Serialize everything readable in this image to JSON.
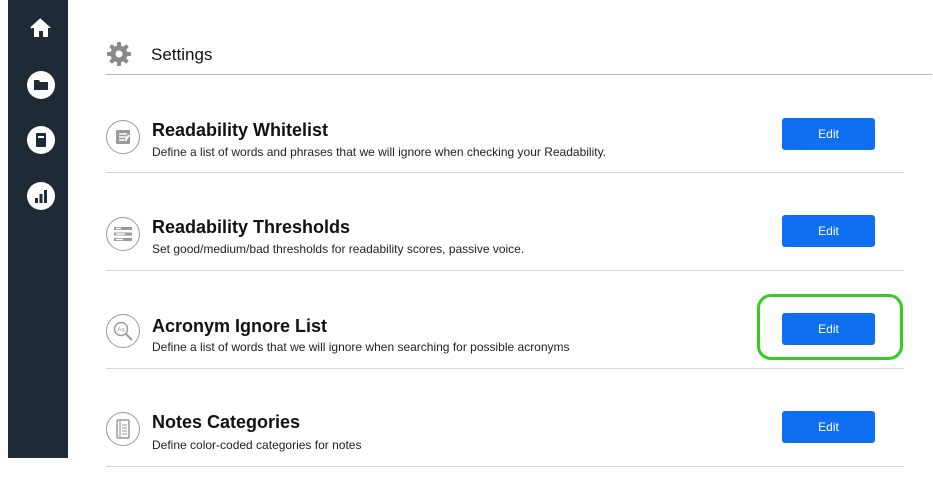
{
  "sidebar": {
    "items": [
      {
        "icon": "home-icon"
      },
      {
        "icon": "folder-icon"
      },
      {
        "icon": "notebook-icon"
      },
      {
        "icon": "bar-chart-icon"
      }
    ]
  },
  "header": {
    "icon": "gear-icon",
    "title": "Settings"
  },
  "settings": [
    {
      "icon": "checklist-icon",
      "title": "Readability Whitelist",
      "description": "Define a list of words and phrases that we will ignore when checking your Readability.",
      "button": "Edit"
    },
    {
      "icon": "sliders-icon",
      "title": "Readability Thresholds",
      "description": "Set good/medium/bad thresholds for readability scores, passive voice.",
      "button": "Edit"
    },
    {
      "icon": "magnifier-icon",
      "title": "Acronym Ignore List",
      "description": "Define a list of words that we will ignore when searching for possible acronyms",
      "button": "Edit"
    },
    {
      "icon": "notepad-icon",
      "title": "Notes Categories",
      "description": "Define color-coded categories for notes",
      "button": "Edit"
    }
  ],
  "colors": {
    "sidebar": "#1f2a37",
    "button": "#0e6ff0",
    "highlight": "#33cc22"
  }
}
